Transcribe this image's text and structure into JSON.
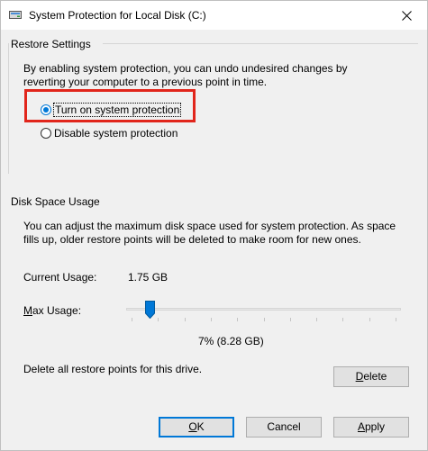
{
  "window": {
    "title": "System Protection for Local Disk (C:)"
  },
  "restore_settings": {
    "group_label": "Restore Settings",
    "description_line1": "By enabling system protection, you can undo undesired changes by",
    "description_line2": "reverting your computer to a previous point in time.",
    "options": [
      {
        "label": "Turn on system protection",
        "selected": true
      },
      {
        "label": "Disable system protection",
        "selected": false
      }
    ]
  },
  "disk_space": {
    "group_label": "Disk Space Usage",
    "description_line1": "You can adjust the maximum disk space used for system protection. As space",
    "description_line2": "fills up, older restore points will be deleted to make room for new ones.",
    "current_usage_label": "Current Usage:",
    "current_usage_value": "1.75 GB",
    "max_usage_label_prefix": "M",
    "max_usage_label_rest": "ax Usage:",
    "max_usage_percent": 7,
    "max_usage_readout": "7% (8.28 GB)",
    "delete_text": "Delete all restore points for this drive.",
    "delete_button_first": "D",
    "delete_button_rest": "elete"
  },
  "footer": {
    "ok_label": "OK",
    "ok_underline": "O",
    "ok_rest": "K",
    "cancel_label": "Cancel",
    "apply_first": "A",
    "apply_rest": "pply"
  },
  "colors": {
    "accent": "#0078d7",
    "highlight": "#e1251b",
    "window_bg": "#f0f0f0"
  },
  "icons": {
    "title_icon": "drive-icon",
    "close_icon": "close-icon",
    "slider_thumb": "slider-thumb"
  }
}
